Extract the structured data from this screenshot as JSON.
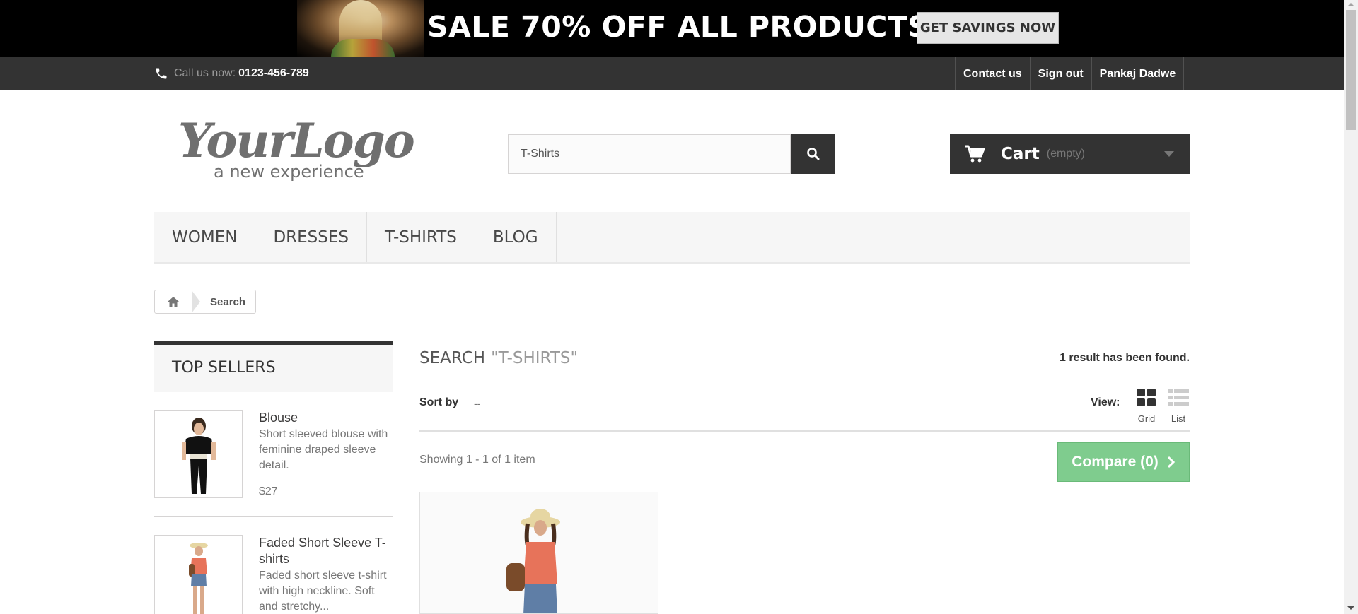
{
  "banner": {
    "text": "SALE 70% OFF ALL PRODUCTS",
    "button_label": "GET SAVINGS NOW"
  },
  "topnav": {
    "call_label": "Call us now:",
    "call_number": "0123-456-789",
    "links": [
      "Contact us",
      "Sign out",
      "Pankaj Dadwe"
    ],
    "icon": "phone-icon"
  },
  "header": {
    "logo_main": "YourLogo",
    "logo_tagline": "a new experience",
    "search_value": "T-Shirts",
    "search_icon": "search-icon",
    "cart_label": "Cart",
    "cart_status": "(empty)",
    "cart_icon": "cart-icon"
  },
  "menu": {
    "items": [
      "Women",
      "Dresses",
      "T-shirts",
      "Blog"
    ]
  },
  "breadcrumb": {
    "home_icon": "home-icon",
    "current": "Search"
  },
  "top_sellers": {
    "title": "Top sellers",
    "items": [
      {
        "name": "Blouse",
        "description": "Short sleeved blouse with feminine draped sleeve detail.",
        "price": "$27"
      },
      {
        "name": "Faded Short Sleeve T-shirts",
        "description": "Faded short sleeve t-shirt with high neckline. Soft and stretchy...",
        "price": ""
      }
    ]
  },
  "results": {
    "heading": "Search",
    "query": "\"T-shirts\"",
    "count_text": "1 result has been found.",
    "sort_label": "Sort by",
    "sort_value": "--",
    "view_label": "View:",
    "view_grid": "Grid",
    "view_list": "List",
    "showing_text": "Showing 1 - 1 of 1 item",
    "compare_label": "Compare (0)"
  },
  "colors": {
    "dark_bar": "#333333",
    "compare_green": "#7fcc8e",
    "menu_bg": "#f6f6f6"
  }
}
